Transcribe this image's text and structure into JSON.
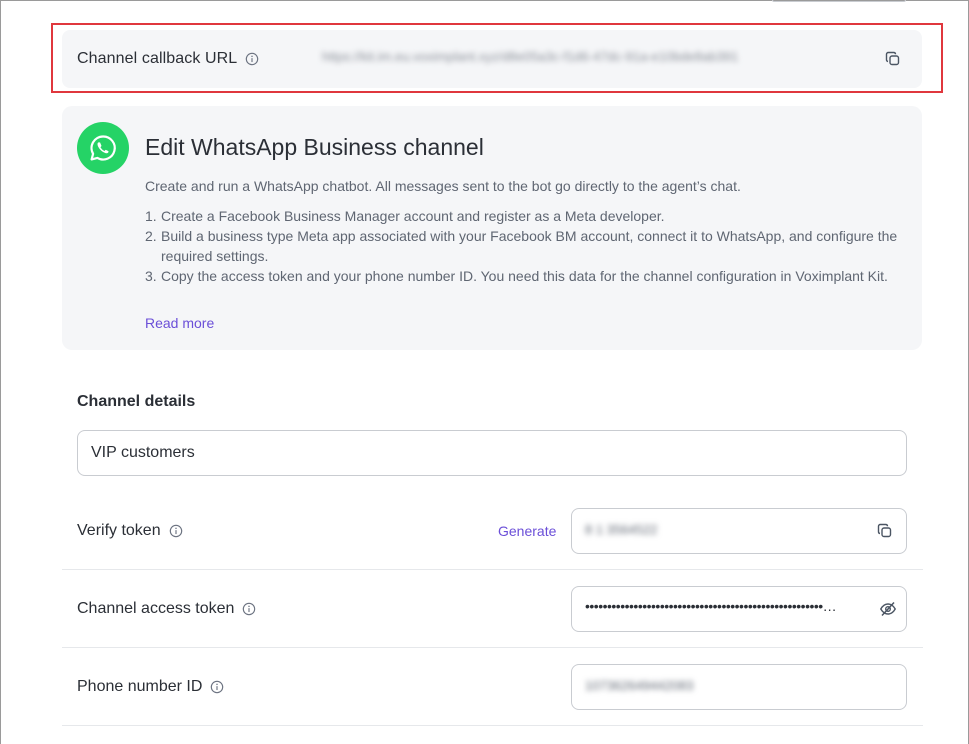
{
  "callback": {
    "label": "Channel callback URL",
    "url": "https://kit.im.eu.voximplant.xyz/d8e05a3c-f1d6-47dc-91a-e10bde8ab391"
  },
  "info_card": {
    "title": "Edit WhatsApp Business channel",
    "description": "Create and run a WhatsApp chatbot. All messages sent to the bot go directly to the agent’s chat.",
    "steps": [
      {
        "num": "1.",
        "text": "Create a Facebook Business Manager account and register as a Meta developer."
      },
      {
        "num": "2.",
        "text": "Build a business type Meta app associated with your Facebook BM account, connect it to WhatsApp, and configure the required settings."
      },
      {
        "num": "3.",
        "text": "Copy the access token and your phone number ID. You need this data for the channel configuration in Voximplant Kit."
      }
    ],
    "read_more": "Read more"
  },
  "channel_details": {
    "title": "Channel details",
    "name_value": "VIP customers"
  },
  "verify_token": {
    "label": "Verify token",
    "generate": "Generate",
    "value": "8 1 3564522"
  },
  "access_token": {
    "label": "Channel access token",
    "value": "••••••••••••••••••••••••••••••••••••••••••••••••••••••…"
  },
  "phone_number_id": {
    "label": "Phone number ID",
    "value": "107362649442083"
  },
  "colors": {
    "accent": "#6b4fd8",
    "whatsapp": "#25d366",
    "highlight": "#e0373d"
  }
}
